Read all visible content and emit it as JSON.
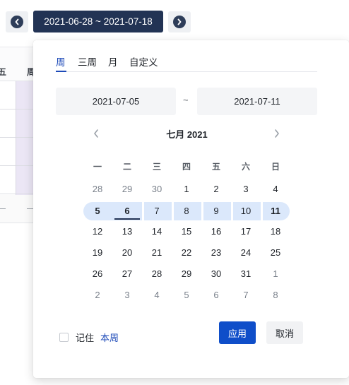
{
  "toolbar": {
    "prev_icon": "chevron-left-icon",
    "range_label": "2021-06-28 ~ 2021-07-18",
    "next_icon": "chevron-right-icon"
  },
  "background_table": {
    "header_fragments": [
      "五",
      "周"
    ]
  },
  "picker": {
    "tabs": [
      "周",
      "三周",
      "月",
      "自定义"
    ],
    "active_tab": "周",
    "start_date": "2021-07-05",
    "separator": "~",
    "end_date": "2021-07-11",
    "month_title": "七月 2021",
    "weekdays": [
      "一",
      "二",
      "三",
      "四",
      "五",
      "六",
      "日"
    ],
    "weeks": [
      [
        "28",
        "29",
        "30",
        "1",
        "2",
        "3",
        "4"
      ],
      [
        "5",
        "6",
        "7",
        "8",
        "9",
        "10",
        "11"
      ],
      [
        "12",
        "13",
        "14",
        "15",
        "16",
        "17",
        "18"
      ],
      [
        "19",
        "20",
        "21",
        "22",
        "23",
        "24",
        "25"
      ],
      [
        "26",
        "27",
        "28",
        "29",
        "30",
        "31",
        "1"
      ],
      [
        "2",
        "3",
        "4",
        "5",
        "6",
        "7",
        "8"
      ]
    ],
    "remember_label": "记住",
    "this_week_link": "本周",
    "apply_label": "应用",
    "cancel_label": "取消"
  },
  "colors": {
    "accent": "#0f4ec9",
    "range_button": "#223354",
    "selected_week": "#dbe8fb",
    "link": "#1d4ab8"
  }
}
